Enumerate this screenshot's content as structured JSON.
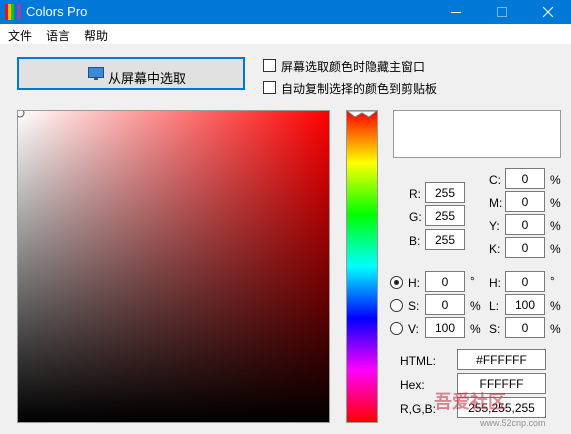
{
  "window": {
    "title": "Colors Pro",
    "minimize_icon": "minimize-icon",
    "maximize_icon": "maximize-icon",
    "close_icon": "close-icon"
  },
  "menu": {
    "file": "文件",
    "language": "语言",
    "help": "帮助"
  },
  "picker": {
    "label": "从屏幕中选取",
    "icon": "monitor-icon",
    "hide_window_label": "屏幕选取颜色时隐藏主窗口",
    "auto_copy_label": "自动复制选择的颜色到剪贴板",
    "hide_window_checked": false,
    "auto_copy_checked": false
  },
  "preview": {
    "color": "#FFFFFF"
  },
  "hue_colors": [
    "#ff0000",
    "#ffff00",
    "#00ff00",
    "#00ffff",
    "#0000ff",
    "#ff00ff",
    "#ff0000"
  ],
  "rgb": {
    "r_label": "R:",
    "r": "255",
    "g_label": "G:",
    "g": "255",
    "b_label": "B:",
    "b": "255"
  },
  "cmyk": {
    "c_label": "C:",
    "c": "0",
    "m_label": "M:",
    "m": "0",
    "y_label": "Y:",
    "y": "0",
    "k_label": "K:",
    "k": "0",
    "unit": "%"
  },
  "hsv": {
    "h_label": "H:",
    "h": "0",
    "h_unit": "°",
    "s_label": "S:",
    "s": "0",
    "s_unit": "%",
    "v_label": "V:",
    "v": "100",
    "v_unit": "%",
    "selected": "H"
  },
  "hsl": {
    "h_label": "H:",
    "h": "0",
    "h_unit": "°",
    "l_label": "L:",
    "l": "100",
    "l_unit": "%",
    "s_label": "S:",
    "s": "0",
    "s_unit": "%"
  },
  "codes": {
    "html_label": "HTML:",
    "html": "#FFFFFF",
    "hex_label": "Hex:",
    "hex": "FFFFFF",
    "rgb_label": "R,G,B:",
    "rgb": "255,255,255"
  },
  "watermark": {
    "text": "吾爱社区",
    "url": "www.52cnp.com"
  }
}
